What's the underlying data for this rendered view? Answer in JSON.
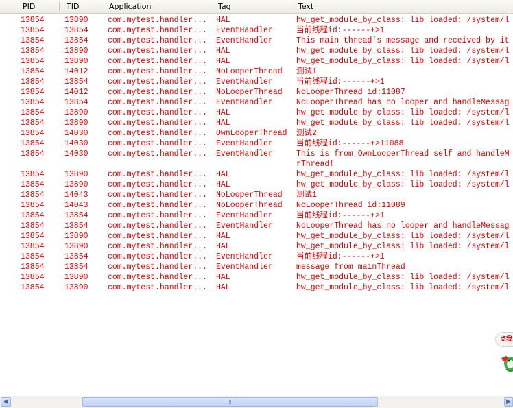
{
  "columns": {
    "pid": "PID",
    "tid": "TID",
    "application": "Application",
    "tag": "Tag",
    "text": "Text"
  },
  "log": [
    {
      "pid": "13854",
      "tid": "13890",
      "app": "com.mytest.handler...",
      "tag": "HAL",
      "text": "hw_get_module_by_class: lib loaded: /system/l"
    },
    {
      "pid": "13854",
      "tid": "13854",
      "app": "com.mytest.handler...",
      "tag": "EventHandler",
      "text": "当前线程id:------+>1"
    },
    {
      "pid": "13854",
      "tid": "13854",
      "app": "com.mytest.handler...",
      "tag": "EventHandler",
      "text": "This main thread's message and received by it"
    },
    {
      "pid": "13854",
      "tid": "13890",
      "app": "com.mytest.handler...",
      "tag": "HAL",
      "text": "hw_get_module_by_class: lib loaded: /system/l"
    },
    {
      "pid": "13854",
      "tid": "13890",
      "app": "com.mytest.handler...",
      "tag": "HAL",
      "text": "hw_get_module_by_class: lib loaded: /system/l"
    },
    {
      "pid": "13854",
      "tid": "14012",
      "app": "com.mytest.handler...",
      "tag": "NoLooperThread",
      "text": "测试1"
    },
    {
      "pid": "13854",
      "tid": "13854",
      "app": "com.mytest.handler...",
      "tag": "EventHandler",
      "text": "当前线程id:------+>1"
    },
    {
      "pid": "13854",
      "tid": "14012",
      "app": "com.mytest.handler...",
      "tag": "NoLooperThread",
      "text": "NoLooperThread id:11087"
    },
    {
      "pid": "13854",
      "tid": "13854",
      "app": "com.mytest.handler...",
      "tag": "EventHandler",
      "text": "NoLooperThread has no looper and handleMessag"
    },
    {
      "pid": "13854",
      "tid": "13890",
      "app": "com.mytest.handler...",
      "tag": "HAL",
      "text": "hw_get_module_by_class: lib loaded: /system/l"
    },
    {
      "pid": "13854",
      "tid": "13890",
      "app": "com.mytest.handler...",
      "tag": "HAL",
      "text": "hw_get_module_by_class: lib loaded: /system/l"
    },
    {
      "pid": "13854",
      "tid": "14030",
      "app": "com.mytest.handler...",
      "tag": "OwnLooperThread",
      "text": "测试2"
    },
    {
      "pid": "13854",
      "tid": "14030",
      "app": "com.mytest.handler...",
      "tag": "EventHandler",
      "text": "当前线程id:------+>11088"
    },
    {
      "pid": "13854",
      "tid": "14030",
      "app": "com.mytest.handler...",
      "tag": "EventHandler",
      "text": "This is from OwnLooperThread self and handleM",
      "text2": "rThread!"
    },
    {
      "pid": "13854",
      "tid": "13890",
      "app": "com.mytest.handler...",
      "tag": "HAL",
      "text": "hw_get_module_by_class: lib loaded: /system/l"
    },
    {
      "pid": "13854",
      "tid": "13890",
      "app": "com.mytest.handler...",
      "tag": "HAL",
      "text": "hw_get_module_by_class: lib loaded: /system/l"
    },
    {
      "pid": "13854",
      "tid": "14043",
      "app": "com.mytest.handler...",
      "tag": "NoLooperThread",
      "text": "测试1"
    },
    {
      "pid": "13854",
      "tid": "14043",
      "app": "com.mytest.handler...",
      "tag": "NoLooperThread",
      "text": "NoLooperThread id:11089"
    },
    {
      "pid": "13854",
      "tid": "13854",
      "app": "com.mytest.handler...",
      "tag": "EventHandler",
      "text": "当前线程id:------+>1"
    },
    {
      "pid": "13854",
      "tid": "13854",
      "app": "com.mytest.handler...",
      "tag": "EventHandler",
      "text": "NoLooperThread has no looper and handleMessag"
    },
    {
      "pid": "13854",
      "tid": "13890",
      "app": "com.mytest.handler...",
      "tag": "HAL",
      "text": "hw_get_module_by_class: lib loaded: /system/l"
    },
    {
      "pid": "13854",
      "tid": "13890",
      "app": "com.mytest.handler...",
      "tag": "HAL",
      "text": "hw_get_module_by_class: lib loaded: /system/l"
    },
    {
      "pid": "13854",
      "tid": "13854",
      "app": "com.mytest.handler...",
      "tag": "EventHandler",
      "text": "当前线程id:------+>1"
    },
    {
      "pid": "13854",
      "tid": "13854",
      "app": "com.mytest.handler...",
      "tag": "EventHandler",
      "text": "message from mainThread"
    },
    {
      "pid": "13854",
      "tid": "13890",
      "app": "com.mytest.handler...",
      "tag": "HAL",
      "text": "hw_get_module_by_class: lib loaded: /system/l"
    },
    {
      "pid": "13854",
      "tid": "13890",
      "app": "com.mytest.handler...",
      "tag": "HAL",
      "text": "hw_get_module_by_class: lib loaded: /system/l"
    }
  ],
  "overlay": {
    "label": "点我"
  },
  "scrollbar": {
    "left_arrow": "◀",
    "right_arrow": "▶"
  },
  "colors": {
    "log_text": "#e60000",
    "header_bg": "#ecebe5",
    "scroll_thumb": "#c9d9f9"
  }
}
